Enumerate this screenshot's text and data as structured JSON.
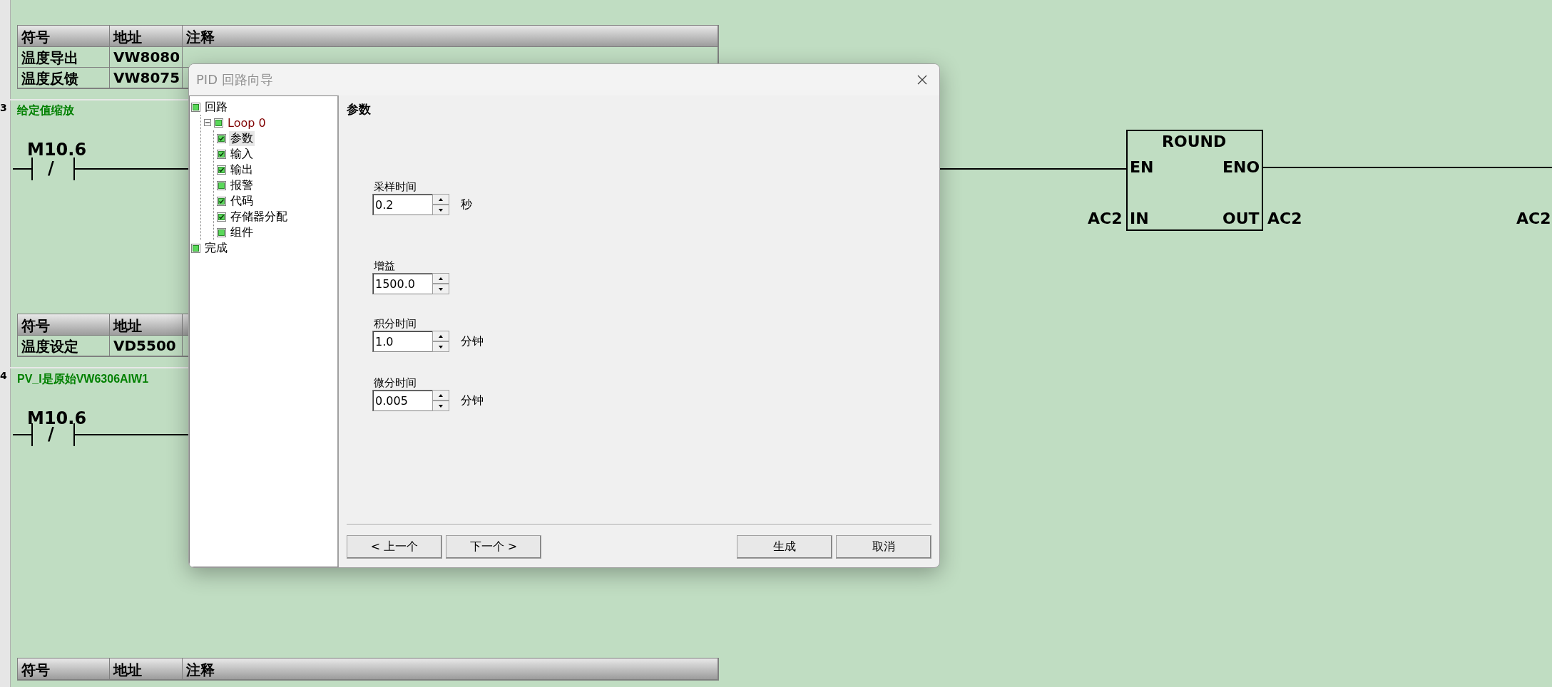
{
  "symbol_tables": [
    {
      "columns": [
        "符号",
        "地址",
        "注释"
      ],
      "rows": [
        {
          "symbol": "温度导出",
          "address": "VW8080"
        },
        {
          "symbol": "温度反馈",
          "address": "VW8075"
        }
      ]
    },
    {
      "columns": [
        "符号",
        "地址"
      ],
      "rows": [
        {
          "symbol": "温度设定",
          "address": "VD5500"
        }
      ]
    },
    {
      "columns": [
        "符号",
        "地址",
        "注释"
      ]
    }
  ],
  "networks": [
    {
      "number": "3",
      "title": "给定值缩放",
      "contact": "M10.6",
      "contact_sign": "/"
    },
    {
      "number": "4",
      "title": "PV_I是原始VW6306AIW1",
      "contact": "M10.6",
      "contact_sign": "/"
    }
  ],
  "round_box": {
    "title": "ROUND",
    "en": "EN",
    "eno": "ENO",
    "in": "IN",
    "out": "OUT",
    "in_operand": "AC2",
    "out_operand": "AC2"
  },
  "next_operand": "AC2",
  "dialog": {
    "title": "PID 回路向导",
    "tree": [
      {
        "label": "回路",
        "checked": false,
        "selected": false,
        "children": [
          {
            "label": "Loop 0",
            "checked": false,
            "selected": false,
            "expanded": true,
            "children": [
              {
                "label": "参数",
                "checked": true,
                "selected": true
              },
              {
                "label": "输入",
                "checked": true,
                "selected": false
              },
              {
                "label": "输出",
                "checked": true,
                "selected": false
              },
              {
                "label": "报警",
                "checked": false,
                "selected": false
              },
              {
                "label": "代码",
                "checked": true,
                "selected": false
              },
              {
                "label": "存储器分配",
                "checked": true,
                "selected": false
              },
              {
                "label": "组件",
                "checked": false,
                "selected": false
              }
            ]
          }
        ]
      },
      {
        "label": "完成",
        "checked": false,
        "selected": false
      }
    ],
    "section_title": "参数",
    "fields": [
      {
        "label": "采样时间",
        "value": "0.2",
        "unit": "秒"
      },
      {
        "label": "增益",
        "value": "1500.0"
      },
      {
        "label": "积分时间",
        "value": "1.0",
        "unit": "分钟"
      },
      {
        "label": "微分时间",
        "value": "0.005",
        "unit": "分钟"
      }
    ],
    "nav_buttons": [
      "< 上一个",
      "下一个 >"
    ],
    "action_buttons": [
      "生成",
      "取消"
    ]
  }
}
